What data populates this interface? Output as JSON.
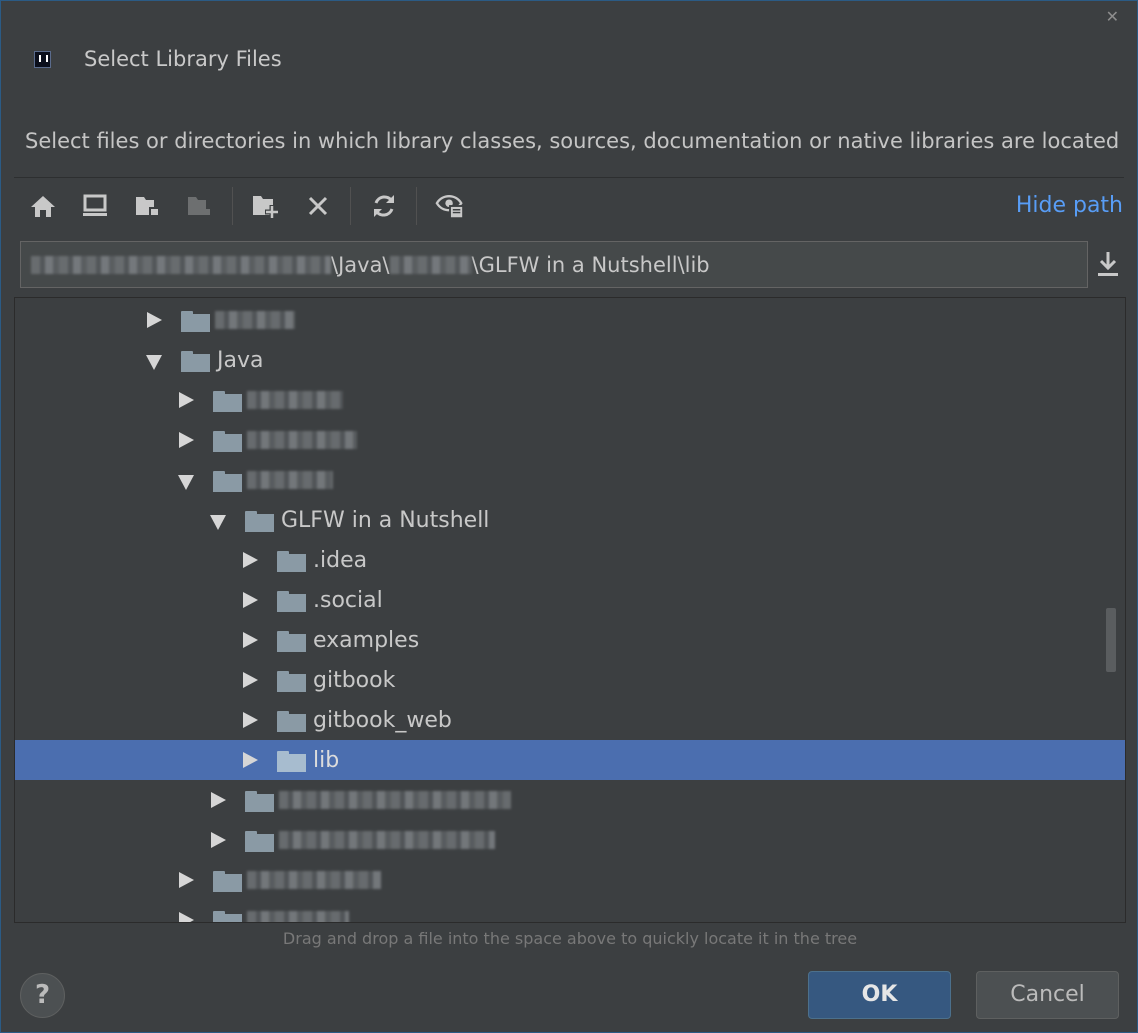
{
  "dialog": {
    "title": "Select Library Files",
    "description": "Select files or directories in which library classes, sources, documentation or native libraries are located",
    "close_glyph": "✕"
  },
  "toolbar": {
    "buttons": [
      "home-icon",
      "desktop-icon",
      "project-folder-icon",
      "module-folder-icon",
      "new-folder-icon",
      "delete-icon",
      "refresh-icon",
      "show-hidden-icon"
    ],
    "hide_path_label": "Hide path"
  },
  "path": {
    "segments": [
      "\\Java\\",
      "\\GLFW in a Nutshell\\lib"
    ]
  },
  "tree": {
    "rows": [
      {
        "label": "",
        "blurred": true,
        "expanded": false,
        "level": 0
      },
      {
        "label": "Java",
        "blurred": false,
        "expanded": true,
        "level": 0
      },
      {
        "label": "",
        "blurred": true,
        "expanded": false,
        "level": 1
      },
      {
        "label": "",
        "blurred": true,
        "expanded": false,
        "level": 1
      },
      {
        "label": "",
        "blurred": true,
        "expanded": true,
        "level": 1
      },
      {
        "label": "GLFW in a Nutshell",
        "blurred": false,
        "expanded": true,
        "level": 2
      },
      {
        "label": ".idea",
        "blurred": false,
        "expanded": false,
        "level": 3
      },
      {
        "label": ".social",
        "blurred": false,
        "expanded": false,
        "level": 3
      },
      {
        "label": "examples",
        "blurred": false,
        "expanded": false,
        "level": 3
      },
      {
        "label": "gitbook",
        "blurred": false,
        "expanded": false,
        "level": 3
      },
      {
        "label": "gitbook_web",
        "blurred": false,
        "expanded": false,
        "level": 3
      },
      {
        "label": "lib",
        "blurred": false,
        "expanded": false,
        "level": 3,
        "selected": true
      },
      {
        "label": "",
        "blurred": true,
        "expanded": false,
        "level": 2
      },
      {
        "label": "",
        "blurred": true,
        "expanded": false,
        "level": 2
      },
      {
        "label": "",
        "blurred": true,
        "expanded": false,
        "level": 1
      },
      {
        "label": "",
        "blurred": true,
        "expanded": false,
        "level": 1
      }
    ]
  },
  "hint": "Drag and drop a file into the space above to quickly locate it in the tree",
  "footer": {
    "help_label": "?",
    "ok_label": "OK",
    "cancel_label": "Cancel"
  },
  "colors": {
    "background": "#3c3f41",
    "selection": "#4b6eaf",
    "link": "#589df6",
    "default_button": "#365880"
  }
}
